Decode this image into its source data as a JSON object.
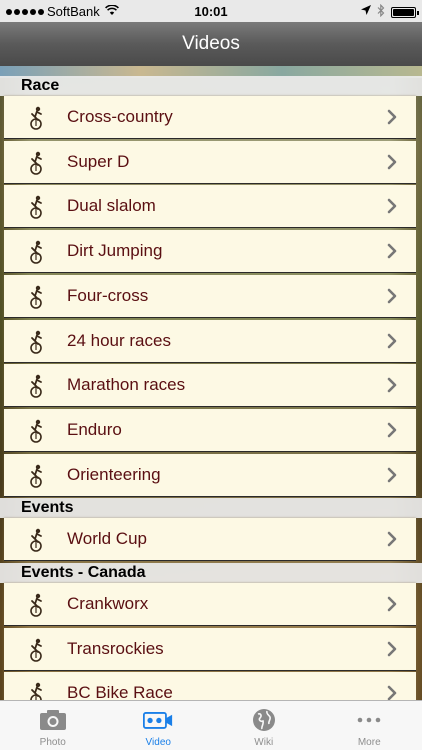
{
  "status_bar": {
    "carrier": "SoftBank",
    "time": "10:01",
    "battery_level": 1.0
  },
  "nav": {
    "title": "Videos"
  },
  "sections": [
    {
      "title": "Race",
      "items": [
        {
          "label": "Cross-country"
        },
        {
          "label": "Super D"
        },
        {
          "label": "Dual slalom"
        },
        {
          "label": "Dirt Jumping"
        },
        {
          "label": "Four-cross"
        },
        {
          "label": "24 hour races"
        },
        {
          "label": "Marathon races"
        },
        {
          "label": "Enduro"
        },
        {
          "label": "Orienteering"
        }
      ]
    },
    {
      "title": "Events",
      "items": [
        {
          "label": "World Cup"
        }
      ]
    },
    {
      "title": "Events - Canada",
      "items": [
        {
          "label": "Crankworx"
        },
        {
          "label": "Transrockies"
        },
        {
          "label": "BC Bike Race"
        }
      ]
    }
  ],
  "tabs": [
    {
      "label": "Photo",
      "icon": "camera-icon",
      "active": false
    },
    {
      "label": "Video",
      "icon": "video-camera-icon",
      "active": true
    },
    {
      "label": "Wiki",
      "icon": "globe-icon",
      "active": false
    },
    {
      "label": "More",
      "icon": "more-icon",
      "active": false
    }
  ],
  "colors": {
    "row_text": "#5a0f12",
    "row_bg": "#fdf9e4",
    "tab_active": "#1a7fe8",
    "tab_inactive": "#8e8e8e"
  }
}
